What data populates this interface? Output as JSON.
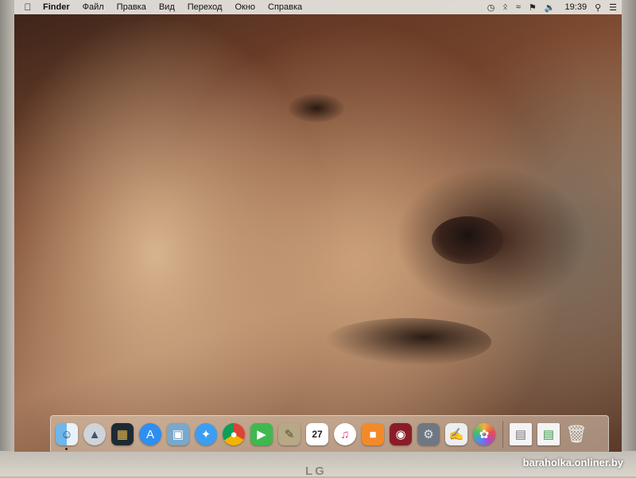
{
  "menubar": {
    "apple_label": "",
    "items": [
      "Finder",
      "Файл",
      "Правка",
      "Вид",
      "Переход",
      "Окно",
      "Справка"
    ],
    "clock": "19:39"
  },
  "dock": {
    "apps": [
      "finder",
      "launchpad",
      "mission-control",
      "app-store",
      "preview",
      "safari",
      "chrome",
      "facetime",
      "notes",
      "calendar",
      "itunes",
      "ibooks",
      "photo-booth",
      "system-preferences",
      "textedit",
      "photos",
      "document-1",
      "document-2",
      "trash"
    ],
    "calendar_day": "27"
  },
  "monitor": {
    "brand": "LG"
  },
  "watermark": "baraholka.onliner.by",
  "colors": {
    "menubar": "#e8e6e2",
    "dock": "#e1cdb9"
  }
}
